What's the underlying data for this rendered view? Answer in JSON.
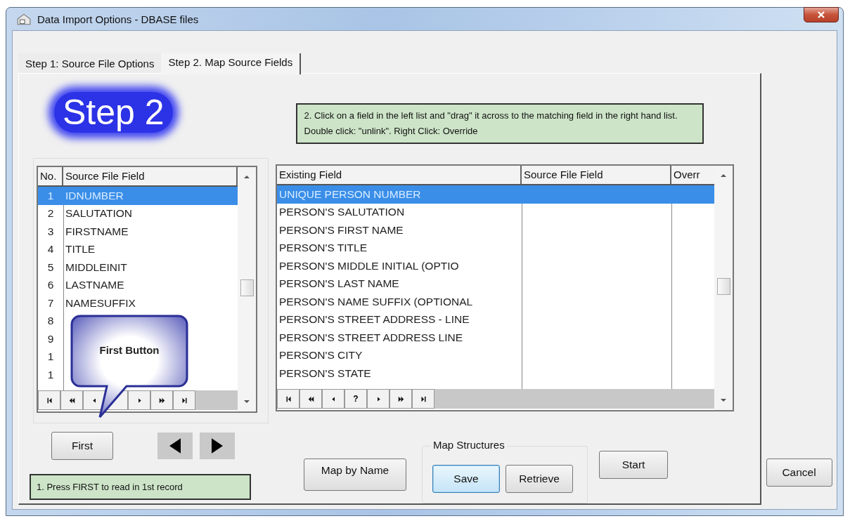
{
  "window": {
    "title": "Data Import Options - DBASE files"
  },
  "tabs": [
    {
      "label": "Step 1: Source File Options",
      "selected": false
    },
    {
      "label": "Step 2. Map Source Fields",
      "selected": true
    }
  ],
  "heading": "Step 2",
  "instructions": "2.  Click on a field in the left list and \"drag\" it across to the matching field in the right hand list.  Double click: \"unlink\". Right Click: Override",
  "source_list": {
    "columns": [
      "No.",
      "Source File Field"
    ],
    "rows": [
      {
        "no": "1",
        "field": "IDNUMBER",
        "selected": true
      },
      {
        "no": "2",
        "field": "SALUTATION",
        "selected": false
      },
      {
        "no": "3",
        "field": "FIRSTNAME",
        "selected": false
      },
      {
        "no": "4",
        "field": "TITLE",
        "selected": false
      },
      {
        "no": "5",
        "field": "MIDDLEINIT",
        "selected": false
      },
      {
        "no": "6",
        "field": "LASTNAME",
        "selected": false
      },
      {
        "no": "7",
        "field": "NAMESUFFIX",
        "selected": false
      },
      {
        "no": "8",
        "selected": false
      },
      {
        "no": "9",
        "selected": false
      },
      {
        "no": "1",
        "selected": false
      },
      {
        "no": "1",
        "selected": false
      }
    ],
    "nav": [
      {
        "kind": "first"
      },
      {
        "kind": "prev_page"
      },
      {
        "kind": "prev"
      },
      {
        "kind": "hidden"
      },
      {
        "kind": "next"
      },
      {
        "kind": "next_page"
      },
      {
        "kind": "last"
      }
    ]
  },
  "callout": "First Button",
  "target_list": {
    "columns": [
      "Existing Field",
      "Source File Field",
      "Overr"
    ],
    "rows": [
      {
        "field": "UNIQUE PERSON NUMBER",
        "selected": true
      },
      {
        "field": "PERSON'S SALUTATION",
        "selected": false
      },
      {
        "field": "PERSON'S FIRST NAME",
        "selected": false
      },
      {
        "field": "PERSON'S TITLE",
        "selected": false
      },
      {
        "field": "PERSON'S MIDDLE INITIAL (OPTIO",
        "selected": false
      },
      {
        "field": "PERSON'S LAST NAME",
        "selected": false
      },
      {
        "field": "PERSON'S NAME SUFFIX (OPTIONAL",
        "selected": false
      },
      {
        "field": "PERSON'S STREET ADDRESS - LINE",
        "selected": false
      },
      {
        "field": "PERSON'S STREET ADDRESS LINE",
        "selected": false
      },
      {
        "field": "PERSON'S CITY",
        "selected": false
      },
      {
        "field": "PERSON'S STATE",
        "selected": false
      }
    ],
    "nav": [
      {
        "kind": "first"
      },
      {
        "kind": "prev_page"
      },
      {
        "kind": "prev"
      },
      {
        "kind": "help",
        "label": "?"
      },
      {
        "kind": "next"
      },
      {
        "kind": "next_page"
      },
      {
        "kind": "last"
      }
    ]
  },
  "first_button": "First",
  "first_note": "1. Press FIRST to read in 1st record",
  "map_by_name_button": "Map by Name",
  "map_structures": {
    "title": "Map Structures",
    "buttons": [
      "Save",
      "Retrieve"
    ]
  },
  "start_button": "Start",
  "cancel_button": "Cancel"
}
